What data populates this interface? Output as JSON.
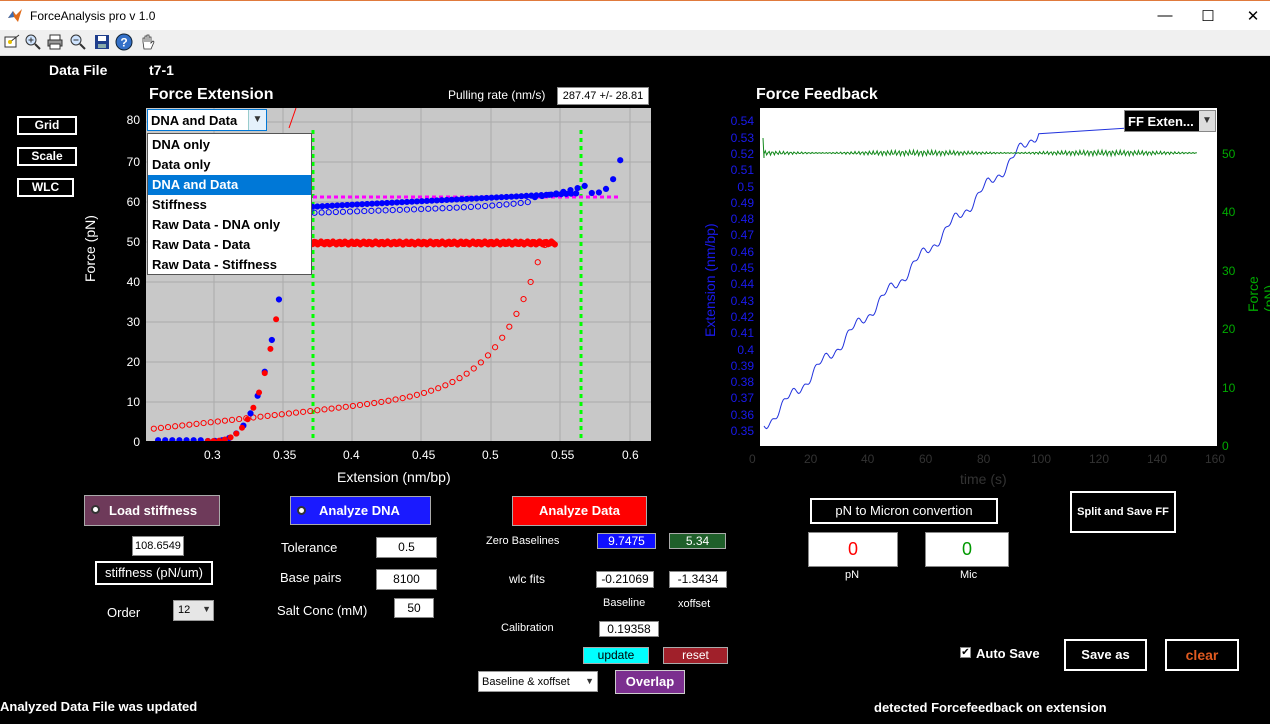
{
  "window": {
    "title": "ForceAnalysis pro v 1.0",
    "minimize": "—",
    "maximize": "☐",
    "close": "✕"
  },
  "toolbar": {
    "icons": [
      "insert-data-cursor-icon",
      "zoom-in-icon",
      "print-icon",
      "zoom-out-icon",
      "save-icon",
      "help-icon",
      "pan-hand-icon"
    ]
  },
  "header": {
    "data_file_label": "Data File",
    "data_file_value": "t7-1"
  },
  "left_buttons": {
    "grid": "Grid",
    "scale": "Scale",
    "wlc": "WLC"
  },
  "force_extension": {
    "title": "Force Extension",
    "pulling_rate_label": "Pulling rate (nm/s)",
    "pulling_rate_value": "287.47 +/- 28.81",
    "dropdown_selected": "DNA and Data",
    "dropdown_options": [
      "DNA only",
      "Data only",
      "DNA and Data",
      "Stiffness",
      "Raw Data - DNA only",
      "Raw Data - Data",
      "Raw Data - Stiffness"
    ],
    "xlabel": "Extension (nm/bp)",
    "ylabel": "Force (pN)",
    "xticks": [
      "0.3",
      "0.35",
      "0.4",
      "0.45",
      "0.5",
      "0.55",
      "0.6"
    ],
    "yticks": [
      "0",
      "10",
      "20",
      "30",
      "40",
      "50",
      "60",
      "70",
      "80"
    ]
  },
  "force_feedback": {
    "title": "Force Feedback",
    "dropdown_selected": "FF Exten...",
    "xlabel": "time (s)",
    "ylabel_left": "Extension (nm/bp)",
    "ylabel_right": "Force (pN)",
    "xticks": [
      "0",
      "20",
      "40",
      "60",
      "80",
      "100",
      "120",
      "140",
      "160"
    ],
    "yticks_left": [
      "0.35",
      "0.36",
      "0.37",
      "0.38",
      "0.39",
      "0.4",
      "0.41",
      "0.42",
      "0.43",
      "0.44",
      "0.45",
      "0.46",
      "0.47",
      "0.48",
      "0.49",
      "0.5",
      "0.51",
      "0.52",
      "0.53",
      "0.54"
    ],
    "yticks_right": [
      "0",
      "10",
      "20",
      "30",
      "40",
      "50"
    ]
  },
  "stiffness_panel": {
    "load_button": "Load stiffness",
    "value": "108.6549",
    "stiffness_button": "stiffness (pN/um)",
    "order_label": "Order",
    "order_value": "12"
  },
  "dna_panel": {
    "analyze_button": "Analyze DNA",
    "tolerance_label": "Tolerance",
    "tolerance_value": "0.5",
    "base_pairs_label": "Base pairs",
    "base_pairs_value": "8100",
    "salt_label": "Salt Conc (mM)",
    "salt_value": "50"
  },
  "data_panel": {
    "analyze_button": "Analyze Data",
    "zero_baselines_label": "Zero Baselines",
    "zero_baseline_1": "9.7475",
    "zero_baseline_2": "5.34",
    "wlc_fits_label": "wlc fits",
    "wlc_fit_baseline": "-0.21069",
    "wlc_fit_xoffset": "-1.3434",
    "baseline_label": "Baseline",
    "xoffset_label": "xoffset",
    "calibration_label": "Calibration",
    "calibration_value": "0.19358",
    "update_button": "update",
    "reset_button": "reset",
    "overlap_select": "Baseline & xoffset",
    "overlap_button": "Overlap"
  },
  "conversion_panel": {
    "button": "pN to Micron convertion",
    "pn_value": "0",
    "mic_value": "0",
    "pn_label": "pN",
    "mic_label": "Mic"
  },
  "split_save_button": "Split and Save FF",
  "auto_save_label": "Auto Save",
  "save_as_button": "Save as",
  "clear_button": "clear",
  "status_left": "Analyzed Data File was updated",
  "status_right": "detected Forcefeedback on extension",
  "colors": {
    "dna_curve": "#0000ff",
    "data_curve": "#ff0000",
    "magenta_line": "#ff00ff",
    "green_line": "#00ff00",
    "plot_bg": "#c8c8c8",
    "ff_extension": "#0000cc",
    "ff_force": "#007700"
  }
}
